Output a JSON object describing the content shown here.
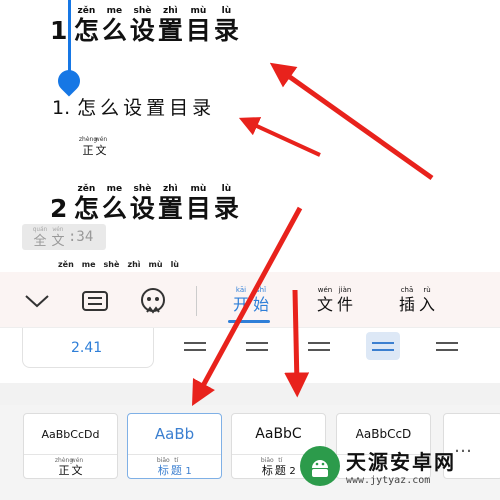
{
  "document": {
    "heading1": {
      "number": "1",
      "chars": [
        {
          "py": "zěn",
          "hz": "怎"
        },
        {
          "py": "me",
          "hz": "么"
        },
        {
          "py": "shè",
          "hz": "设"
        },
        {
          "py": "zhì",
          "hz": "置"
        },
        {
          "py": "mù",
          "hz": "目"
        },
        {
          "py": "lù",
          "hz": "录"
        }
      ]
    },
    "heading1_1": {
      "number": "1.",
      "chars": [
        {
          "py": "",
          "hz": "怎"
        },
        {
          "py": "",
          "hz": "么"
        },
        {
          "py": "",
          "hz": "设"
        },
        {
          "py": "",
          "hz": "置"
        },
        {
          "py": "",
          "hz": "目"
        },
        {
          "py": "",
          "hz": "录"
        }
      ]
    },
    "body": [
      {
        "py": "zhèng",
        "hz": "正"
      },
      {
        "py": "wén",
        "hz": "文"
      }
    ],
    "heading2": {
      "number": "2",
      "chars": [
        {
          "py": "zěn",
          "hz": "怎"
        },
        {
          "py": "me",
          "hz": "么"
        },
        {
          "py": "shè",
          "hz": "设"
        },
        {
          "py": "zhì",
          "hz": "置"
        },
        {
          "py": "mù",
          "hz": "目"
        },
        {
          "py": "lù",
          "hz": "录"
        }
      ]
    },
    "partial_pinyin": [
      "zěn",
      "me",
      "shè",
      "zhì",
      "mù",
      "lù"
    ],
    "wordcount": {
      "chars": [
        {
          "py": "quán",
          "hz": "全"
        },
        {
          "py": "wén",
          "hz": "文"
        }
      ],
      "value": ":34"
    }
  },
  "toolbar": {
    "collapse_icon": "chevron-down-icon",
    "keyboard_icon": "keyboard-icon",
    "assistant_icon": "face-icon",
    "tabs": [
      {
        "chars": [
          {
            "py": "kāi",
            "hz": "开"
          },
          {
            "py": "shǐ",
            "hz": "始"
          }
        ],
        "active": true
      },
      {
        "chars": [
          {
            "py": "wén",
            "hz": "文"
          },
          {
            "py": "jiàn",
            "hz": "件"
          }
        ],
        "active": false
      },
      {
        "chars": [
          {
            "py": "chā",
            "hz": "插"
          },
          {
            "py": "rù",
            "hz": "入"
          }
        ],
        "active": false
      }
    ]
  },
  "format_panel": {
    "font_size": "2.41",
    "align_options": [
      "align-left-icon",
      "align-center-icon",
      "align-right-icon",
      "align-justify-icon",
      "align-distributed-icon"
    ],
    "active_align_index": 3
  },
  "styles": [
    {
      "sample": "AaBbCcDd",
      "caption_chars": [
        {
          "py": "zhèng",
          "hz": "正"
        },
        {
          "py": "wén",
          "hz": "文"
        }
      ],
      "digit": "",
      "active": false
    },
    {
      "sample": "AaBb",
      "caption_chars": [
        {
          "py": "biāo",
          "hz": "标"
        },
        {
          "py": "tí",
          "hz": "题"
        }
      ],
      "digit": "1",
      "active": true
    },
    {
      "sample": "AaBbC",
      "caption_chars": [
        {
          "py": "biāo",
          "hz": "标"
        },
        {
          "py": "tí",
          "hz": "题"
        }
      ],
      "digit": "2",
      "active": false
    },
    {
      "sample": "AaBbCcD",
      "caption_chars": [
        {
          "py": "",
          "hz": ""
        }
      ],
      "digit": "",
      "active": false
    }
  ],
  "more_label": "…",
  "watermark": {
    "title": "天源安卓网",
    "url": "www.jytyaz.com"
  },
  "colors": {
    "accent": "#2f7fd8",
    "arrow": "#e8221c",
    "toolbar_bg": "#fbf4f3"
  }
}
